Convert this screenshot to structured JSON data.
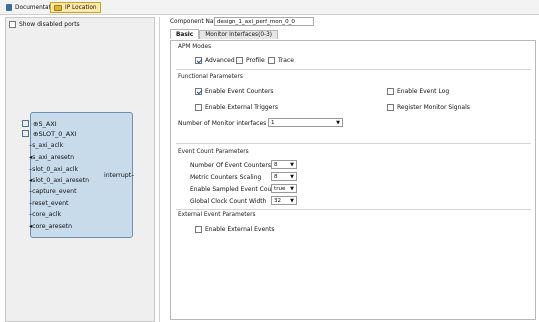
{
  "top_tabs": [
    {
      "label": "Documentation",
      "icon": "document-icon",
      "active": false
    },
    {
      "label": "IP Location",
      "icon": "folder-icon",
      "active": true
    }
  ],
  "left": {
    "show_disabled_ports": "Show disabled ports",
    "block": {
      "left_ports": [
        "S_AXI",
        "SLOT_0_AXI",
        "s_axi_aclk",
        "s_axi_aresetn",
        "slot_0_axi_aclk",
        "slot_0_axi_aresetn",
        "capture_event",
        "reset_event",
        "core_aclk",
        "core_aresetn"
      ],
      "right_ports": [
        "interrupt"
      ]
    }
  },
  "right": {
    "component_name_label": "Component Name",
    "component_name_value": "design_1_axi_perf_mon_0_0",
    "tabs": [
      "Basic",
      "Monitor Interfaces(0-3)"
    ],
    "sections": {
      "apm_modes": {
        "title": "APM Modes",
        "options": [
          {
            "label": "Advanced",
            "checked": true
          },
          {
            "label": "Profile",
            "checked": false
          },
          {
            "label": "Trace",
            "checked": false
          }
        ]
      },
      "functional": {
        "title": "Functional Parameters",
        "enable_event_counters": {
          "label": "Enable Event Counters",
          "checked": true
        },
        "enable_event_log": {
          "label": "Enable Event Log",
          "checked": false
        },
        "enable_external_triggers": {
          "label": "Enable External Triggers",
          "checked": false
        },
        "register_monitor_signals": {
          "label": "Register Monitor Signals",
          "checked": false
        },
        "num_monitor_label": "Number of Monitor interfaces",
        "num_monitor_value": "1"
      },
      "event_count": {
        "title": "Event Count Parameters",
        "rows": [
          {
            "label": "Number Of Event Counters",
            "value": "8"
          },
          {
            "label": "Metric Counters Scaling",
            "value": "8"
          },
          {
            "label": "Enable Sampled Event Counters",
            "value": "true"
          },
          {
            "label": "Global Clock Count Width",
            "value": "32"
          }
        ]
      },
      "external_event": {
        "title": "External Event Parameters",
        "enable_external_events": {
          "label": "Enable External Events",
          "checked": false
        }
      }
    }
  }
}
